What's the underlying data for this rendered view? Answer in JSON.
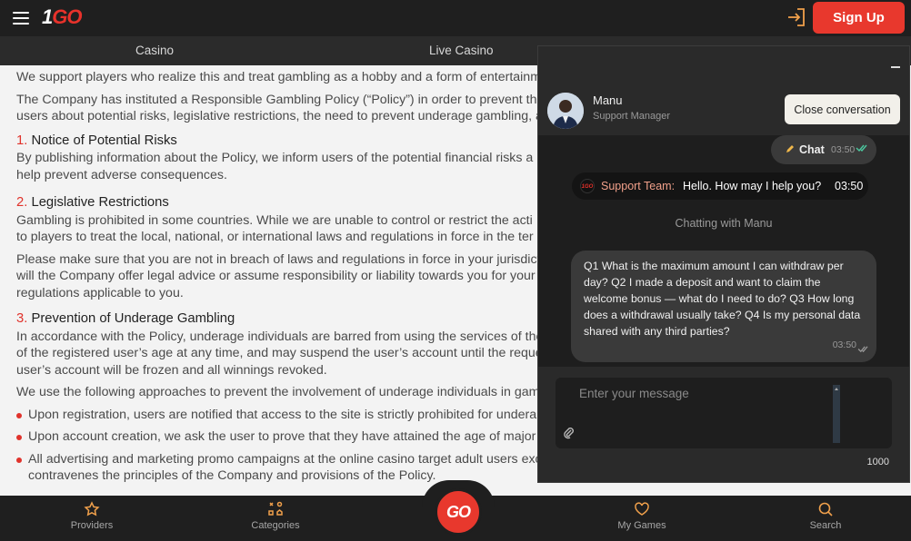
{
  "header": {
    "logo_one": "1",
    "logo_go": "GO",
    "signup_label": "Sign Up",
    "login_icon": "login-icon",
    "menu_icon": "hamburger-icon"
  },
  "nav": {
    "tabs": [
      {
        "label": "Casino"
      },
      {
        "label": "Live Casino"
      }
    ]
  },
  "content": {
    "p1": "We support players who realize this and treat gambling as a hobby and a form of entertainm",
    "p2a": "The Company has instituted a Responsible Gambling Policy (“Policy”) in order to prevent the",
    "p2b": "users about potential risks, legislative restrictions, the need to prevent underage gambling, a",
    "s1_num": "1.",
    "s1_title": "Notice of Potential Risks",
    "s1_p_a": "By publishing information about the Policy, we inform users of the potential financial risks a",
    "s1_p_b": "help prevent adverse consequences.",
    "s2_num": "2.",
    "s2_title": "Legislative Restrictions",
    "s2_p1_a": "Gambling is prohibited in some countries. While we are unable to control or restrict the acti",
    "s2_p1_b": "to players to treat the local, national, or international laws and regulations in force in the ter",
    "s2_p2_a": "Please make sure that you are not in breach of laws and regulations in force in your jurisdict",
    "s2_p2_b": "will the Company offer legal advice or assume responsibility or liability towards you for your",
    "s2_p2_c": "regulations applicable to you.",
    "s3_num": "3.",
    "s3_title": "Prevention of Underage Gambling",
    "s3_p1_a": "In accordance with the Policy, underage individuals are barred from using the services of the",
    "s3_p1_b": "of the registered user’s age at any time, and may suspend the user’s account until the reque",
    "s3_p1_c": "user’s account will be frozen and all winnings revoked.",
    "s3_p2": "We use the following approaches to prevent the involvement of underage individuals in gam",
    "bullets": [
      {
        "text": "Upon registration, users are notified that access to the site is strictly prohibited for undera"
      },
      {
        "text": "Upon account creation, we ask the user to prove that they have attained the age of major"
      },
      {
        "text_a": "All advertising and marketing promo campaigns at the online casino target adult users exc",
        "text_b": "contravenes the principles of the Company and provisions of the Policy."
      }
    ]
  },
  "chat": {
    "agent_name": "Manu",
    "agent_role": "Support Manager",
    "close_label": "Close conversation",
    "pill_label": "Chat",
    "pill_time": "03:50",
    "team_label": "Support Team:",
    "team_text": "Hello. How may I help you?",
    "team_time": "03:50",
    "chatting_with": "Chatting with Manu",
    "user_message": "Q1 What is the maximum amount I can withdraw per day? Q2 I made a deposit and want to claim the welcome bonus — what do I need to do? Q3 How long does a withdrawal usually take? Q4 Is my personal data shared with any third parties?",
    "user_time": "03:50",
    "input_placeholder": "Enter your message",
    "char_limit": "1000"
  },
  "bottom_nav": {
    "items": [
      {
        "label": "Providers",
        "icon": "star-icon"
      },
      {
        "label": "Categories",
        "icon": "categories-icon"
      },
      {
        "label": "My Games",
        "icon": "heart-icon"
      },
      {
        "label": "Search",
        "icon": "search-icon"
      }
    ],
    "go_label": "GO"
  },
  "colors": {
    "accent": "#e8382d",
    "header_bg": "#1f1f1f",
    "chat_bg": "#2a2a2a"
  }
}
